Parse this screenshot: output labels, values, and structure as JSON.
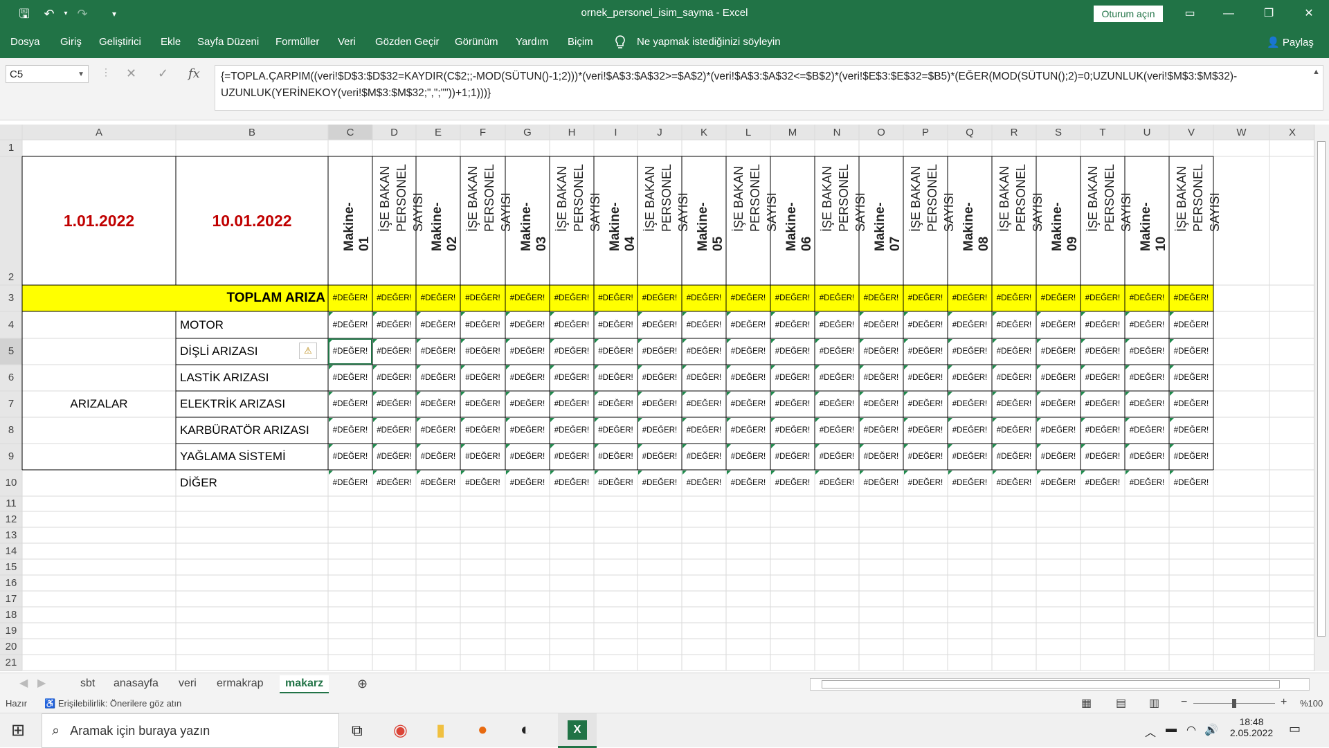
{
  "window": {
    "title": "ornek_personel_isim_sayma  -  Excel",
    "signin_label": "Oturum açın"
  },
  "ribbon": {
    "tabs": [
      "Dosya",
      "Giriş",
      "Geliştirici",
      "Ekle",
      "Sayfa Düzeni",
      "Formüller",
      "Veri",
      "Gözden Geçir",
      "Görünüm",
      "Yardım",
      "Biçim"
    ],
    "tell_me": "Ne yapmak istediğinizi söyleyin",
    "share": "Paylaş"
  },
  "formula_bar": {
    "name_box": "C5",
    "fx": "fx",
    "formula": "{=TOPLA.ÇARPIM((veri!$D$3:$D$32=KAYDIR(C$2;;-MOD(SÜTUN()-1;2)))*(veri!$A$3:$A$32>=$A$2)*(veri!$A$3:$A$32<=$B$2)*(veri!$E$3:$E$32=$B5)*(EĞER(MOD(SÜTUN();2)=0;UZUNLUK(veri!$M$3:$M$32)-UZUNLUK(YERİNEKOY(veri!$M$3:$M$32;\",\";\"\"))+1;1)))}"
  },
  "sheet": {
    "columns": [
      "A",
      "B",
      "C",
      "D",
      "E",
      "F",
      "G",
      "H",
      "I",
      "J",
      "K",
      "L",
      "M",
      "N",
      "O",
      "P",
      "Q",
      "R",
      "S",
      "T",
      "U",
      "V",
      "W",
      "X"
    ],
    "rows": [
      "1",
      "2",
      "3",
      "4",
      "5",
      "6",
      "7",
      "8",
      "9",
      "10",
      "11",
      "12",
      "13",
      "14",
      "15",
      "16",
      "17",
      "18",
      "19",
      "20",
      "21"
    ],
    "start_date": "1.01.2022",
    "end_date": "10.01.2022",
    "machines": [
      "Makine-01",
      "Makine-02",
      "Makine-03",
      "Makine-04",
      "Makine-05",
      "Makine-06",
      "Makine-07",
      "Makine-08",
      "Makine-09",
      "Makine-10"
    ],
    "personnel_header": "İŞE BAKAN\nPERSONEL SAYISI",
    "total_label": "TOPLAM ARIZA",
    "faults_group": "ARIZALAR",
    "faults": [
      "MOTOR",
      "DİŞLİ ARIZASI",
      "LASTİK ARIZASI",
      "ELEKTRİK ARIZASI",
      "KARBÜRATÖR ARIZASI",
      "YAĞLAMA SİSTEMİ",
      "DİĞER"
    ],
    "error_value": "#DEĞER!",
    "total_fill": "#ffff00",
    "date_color": "#c00000"
  },
  "sheet_tabs": [
    "sbt",
    "anasayfa",
    "veri",
    "ermakrap",
    "makarz"
  ],
  "active_tab": "makarz",
  "status": {
    "ready": "Hazır",
    "accessibility": "Erişilebilirlik: Önerilere göz atın",
    "zoom": "%100"
  },
  "taskbar": {
    "search_placeholder": "Aramak için buraya yazın",
    "time": "18:48",
    "date": "2.05.2022"
  },
  "colors": {
    "excel_green": "#217346"
  }
}
